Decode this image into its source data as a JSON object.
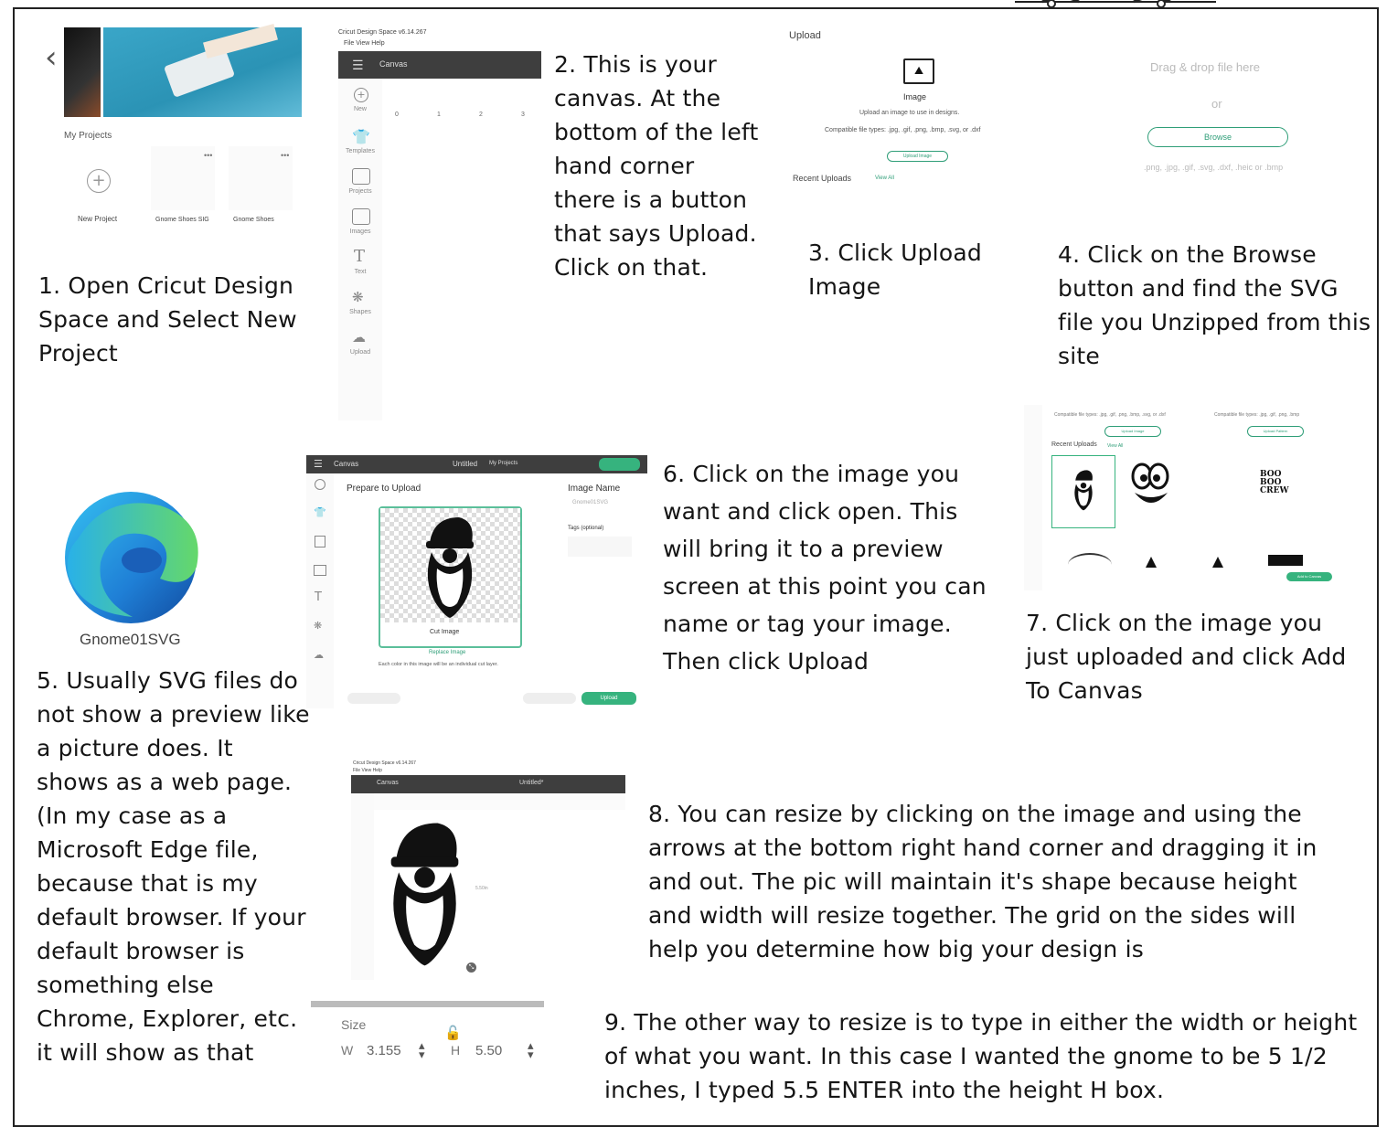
{
  "steps": {
    "s1": "1. Open Cricut Design Space and Select New Project",
    "s2": "2. This is your canvas. At the bottom of the left hand corner there is a button that says Upload. Click on that.",
    "s3": "3. Click Upload Image",
    "s4": "4. Click on the Browse button and find the SVG file you Unzipped from this site",
    "s5": "5. Usually SVG files do not show a preview like a picture does.  It shows as a web page. (In my case as a Microsoft Edge file, because that is my default browser.  If your default browser is something else Chrome, Explorer, etc. it will show as that",
    "s6": "6. Click on the image you want and click open. This will bring it to a preview screen at this point you can name or tag your image. Then click Upload",
    "s7": "7. Click on the image  you just uploaded and click Add To Canvas",
    "s8": "8. You can resize by clicking on the image and using the arrows at the bottom right hand corner and dragging it in and out. The pic will  maintain it's shape because height and width will resize together. The grid on the sides will help you determine how big your design is",
    "s9": "9. The other way to resize is to type in either the width or height of what you want. In this case I wanted the gnome to be 5 1/2 inches, I typed 5.5 ENTER into the height H box."
  },
  "shot1": {
    "my_projects": "My Projects",
    "new_project": "New Project",
    "proj_a": "Gnome Shoes SIG",
    "proj_b": "Gnome Shoes"
  },
  "shot2": {
    "app_title": "Cricut Design Space  v6.14.267",
    "menu": "File   View   Help",
    "canvas_tab": "Canvas",
    "side": [
      "New",
      "Templates",
      "Projects",
      "Images",
      "Text",
      "Shapes",
      "Upload"
    ],
    "ruler": [
      "0",
      "1",
      "2",
      "3"
    ]
  },
  "shot3": {
    "upload": "Upload",
    "image": "Image",
    "desc": "Upload an image to use in designs.",
    "types": "Compatible file types: .jpg, .gif, .png, .bmp, .svg, or .dxf",
    "btn": "Upload Image",
    "recent": "Recent Uploads",
    "view_all": "View All"
  },
  "shot4": {
    "drag": "Drag & drop file here",
    "or": "or",
    "browse": "Browse",
    "types": ".png, .jpg, .gif, .svg, .dxf, .heic or .bmp"
  },
  "shot5": {
    "file_label": "Gnome01SVG"
  },
  "shot6": {
    "canvas": "Canvas",
    "untitled": "Untitled",
    "my_projects": "My Projects",
    "title": "Prepare to Upload",
    "image_name": "Image Name",
    "name_val": "Gnome01SVG",
    "tags": "Tags (optional)",
    "cut_image": "Cut Image",
    "replace": "Replace Image",
    "note": "Each color in this image will be an individual cut layer.",
    "upload_btn": "Upload",
    "side": [
      "New",
      "Templates",
      "Projects",
      "Images",
      "Text",
      "Shapes",
      "Upload"
    ]
  },
  "shot7": {
    "types_a": "Compatible file types: .jpg, .gif, .png, .bmp, .svg, or .dxf",
    "types_b": "Compatible file types: .jpg, .gif, .png, .bmp",
    "btn_a": "Upload Image",
    "btn_b": "Upload Pattern",
    "recent": "Recent Uploads",
    "view_all": "View All",
    "boo": "BOO BOO CREW",
    "add_btn": "Add to Canvas"
  },
  "shot8": {
    "title": "Cricut Design Space  v6.14.267",
    "menu": "File   View   Help",
    "canvas": "Canvas",
    "untitled": "Untitled*",
    "dim": "5.50in"
  },
  "shot9": {
    "size": "Size",
    "w": "W",
    "w_val": "3.155",
    "h": "H",
    "h_val": "5.50"
  },
  "colors": {
    "accent": "#36b37e",
    "dark_bar": "#3e3e3e",
    "text": "#151515"
  }
}
